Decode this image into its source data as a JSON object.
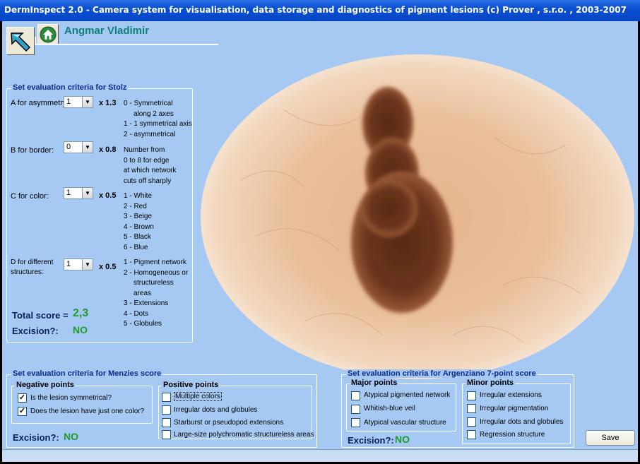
{
  "window": {
    "title": "DermInspect 2.0 - Camera system for visualisation, data storage and diagnostics of pigment lesions (c) Prover , s.r.o. , 2003-2007"
  },
  "header": {
    "patient_name": "Angmar Vladimir",
    "back_icon": "back-arrow-icon",
    "home_icon": "home-icon"
  },
  "stolz": {
    "title": "Set evaluation criteria for Stolz",
    "a": {
      "label": "A for asymmetry:",
      "value": "1",
      "multiplier": "x 1.3",
      "desc": [
        "0 - Symmetrical",
        "along 2 axes",
        "1 - 1 symmetrical axis",
        "2 - asymmetrical"
      ]
    },
    "b": {
      "label": "B for border:",
      "value": "0",
      "multiplier": "x 0.8",
      "desc": [
        "Number from",
        "0 to 8 for edge",
        "at which network",
        "cuts off sharply"
      ]
    },
    "c": {
      "label": "C for color:",
      "value": "1",
      "multiplier": "x 0.5",
      "desc": [
        "1 - White",
        "2 - Red",
        "3 - Beige",
        "4 - Brown",
        "5 - Black",
        "6 - Blue"
      ]
    },
    "d": {
      "label_line1": "D for different",
      "label_line2": "structures:",
      "value": "1",
      "multiplier": "x 0.5",
      "desc": [
        "1 - Pigment network",
        "2 - Homogeneous or",
        "structureless areas",
        "3 - Extensions",
        "4 - Dots",
        "5 - Globules"
      ]
    },
    "total_label": "Total score =",
    "total_value": "2,3",
    "excision_label": "Excision?:",
    "excision_value": "NO"
  },
  "menzies": {
    "title": "Set evaluation criteria for Menzies score",
    "negative_title": "Negative points",
    "negative": [
      {
        "label": "Is the lesion symmetrical?",
        "checked": true
      },
      {
        "label": "Does the lesion have just one color?",
        "checked": true
      }
    ],
    "positive_title": "Positive points",
    "positive": [
      {
        "label": "Multiple colors",
        "checked": false
      },
      {
        "label": "Irregular dots and globules",
        "checked": false
      },
      {
        "label": "Starburst or pseudopod extensions",
        "checked": false
      },
      {
        "label": "Large-size polychromatic structureless areas",
        "checked": false
      }
    ],
    "excision_label": "Excision?:",
    "excision_value": "NO"
  },
  "argenziano": {
    "title": "Set evaluation criteria for Argenziano 7-point score",
    "major_title": "Major points",
    "major": [
      {
        "label": "Atypical pigmented network",
        "checked": false
      },
      {
        "label": "Whitish-blue veil",
        "checked": false
      },
      {
        "label": "Atypical vascular structure",
        "checked": false
      }
    ],
    "minor_title": "Minor points",
    "minor": [
      {
        "label": "Irregular extensions",
        "checked": false
      },
      {
        "label": "Irregular pigmentation",
        "checked": false
      },
      {
        "label": "Irregular dots and globules",
        "checked": false
      },
      {
        "label": "Regression structure",
        "checked": false
      }
    ],
    "excision_label": "Excision?:",
    "excision_value": "NO"
  },
  "buttons": {
    "save": "Save"
  },
  "colors": {
    "client_bg": "#a6c9f3",
    "group_title": "#0a2a8a",
    "result_green": "#1e9a2a",
    "patient_name": "#0e7f7f",
    "titlebar": "#0a4fd3"
  }
}
